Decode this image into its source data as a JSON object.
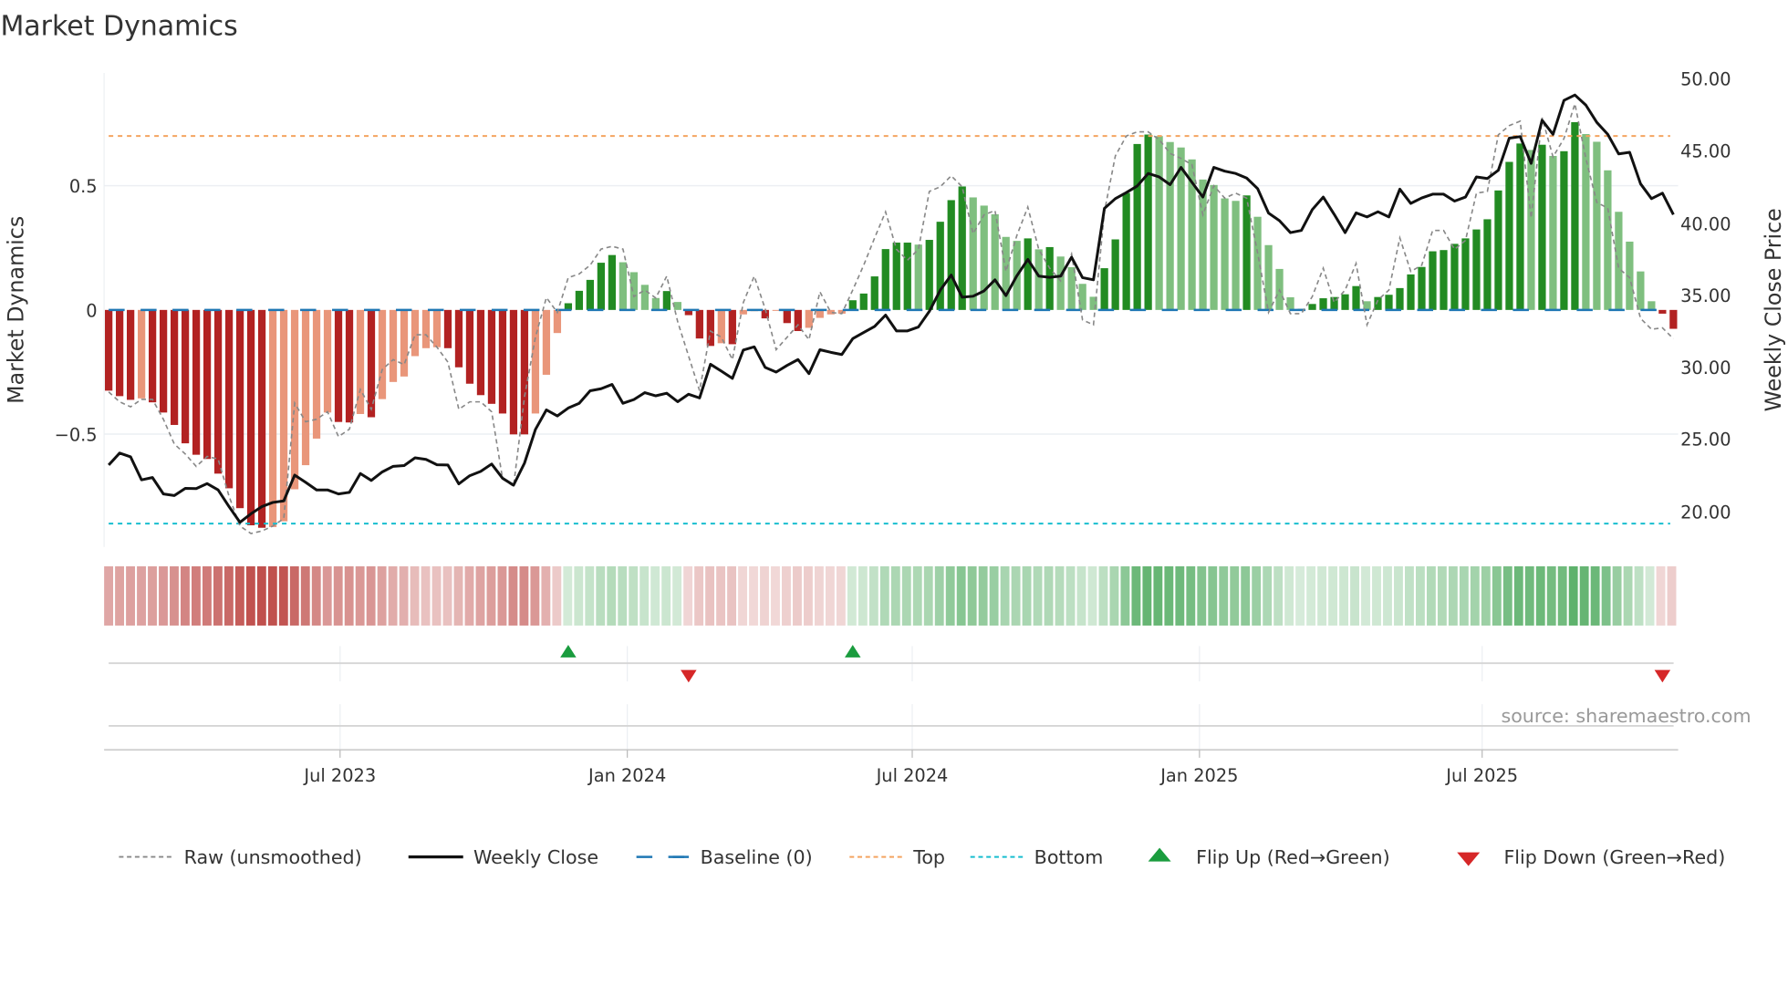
{
  "title": "Market Dynamics",
  "source": "source: sharemaestro.com",
  "colors": {
    "neg_strong": "#b22222",
    "neg_weak": "#e9967a",
    "pos_strong": "#228b22",
    "pos_weak": "#7fbf7f",
    "close": "#111111",
    "raw": "#888888",
    "baseline": "#1f77b4",
    "top": "#f4a460",
    "bottom": "#17becf",
    "flip_up": "#1a9c3e",
    "flip_down": "#d62728",
    "heat_neg": "#c0504d",
    "heat_pos": "#4aa85a"
  },
  "legend": {
    "raw": "Raw (unsmoothed)",
    "close": "Weekly Close",
    "baseline": "Baseline (0)",
    "top": "Top",
    "bottom": "Bottom",
    "flip_up": "Flip Up (Red→Green)",
    "flip_down": "Flip Down (Green→Red)"
  },
  "chart_data": {
    "type": "bar",
    "title": "Market Dynamics",
    "ylabel": "Market Dynamics",
    "y2label": "Weekly Close Price",
    "ylim": [
      -0.95,
      0.95
    ],
    "y2lim": [
      17.5,
      51
    ],
    "yticks": [
      "0.5",
      "0",
      "−0.5"
    ],
    "y2ticks": [
      "50.00",
      "45.00",
      "40.00",
      "35.00",
      "30.00",
      "25.00",
      "20.00"
    ],
    "xticks": [
      "Jul 2023",
      "Jan 2024",
      "Jul 2024",
      "Jan 2025",
      "Jul 2025"
    ],
    "levels": {
      "top": 0.7,
      "baseline": 0,
      "bottom": -0.86
    },
    "flips": {
      "up": [
        42,
        68
      ],
      "down": [
        53,
        142
      ]
    },
    "series": [
      {
        "name": "Market Dynamics (smoothed)",
        "type": "bar",
        "values": [
          -0.325,
          -0.347,
          -0.362,
          -0.356,
          -0.372,
          -0.413,
          -0.463,
          -0.537,
          -0.583,
          -0.6,
          -0.659,
          -0.718,
          -0.798,
          -0.867,
          -0.877,
          -0.874,
          -0.851,
          -0.722,
          -0.625,
          -0.518,
          -0.413,
          -0.451,
          -0.453,
          -0.419,
          -0.432,
          -0.359,
          -0.29,
          -0.268,
          -0.186,
          -0.154,
          -0.15,
          -0.154,
          -0.231,
          -0.297,
          -0.343,
          -0.378,
          -0.417,
          -0.501,
          -0.501,
          -0.417,
          -0.261,
          -0.093,
          0.027,
          0.077,
          0.121,
          0.19,
          0.221,
          0.192,
          0.152,
          0.101,
          0.048,
          0.076,
          0.032,
          -0.021,
          -0.115,
          -0.145,
          -0.134,
          -0.138,
          -0.018,
          -0.005,
          -0.034,
          -0.003,
          -0.053,
          -0.085,
          -0.072,
          -0.032,
          -0.018,
          -0.015,
          0.039,
          0.066,
          0.135,
          0.245,
          0.271,
          0.271,
          0.263,
          0.282,
          0.355,
          0.442,
          0.497,
          0.453,
          0.42,
          0.385,
          0.294,
          0.278,
          0.288,
          0.244,
          0.253,
          0.215,
          0.172,
          0.105,
          0.053,
          0.168,
          0.284,
          0.471,
          0.668,
          0.706,
          0.7,
          0.676,
          0.654,
          0.606,
          0.525,
          0.503,
          0.449,
          0.439,
          0.461,
          0.375,
          0.261,
          0.165,
          0.051,
          0.005,
          0.024,
          0.047,
          0.052,
          0.063,
          0.096,
          0.035,
          0.052,
          0.061,
          0.088,
          0.143,
          0.173,
          0.236,
          0.241,
          0.266,
          0.288,
          0.324,
          0.365,
          0.481,
          0.596,
          0.67,
          0.644,
          0.665,
          0.62,
          0.639,
          0.756,
          0.708,
          0.677,
          0.562,
          0.395,
          0.275,
          0.155,
          0.035,
          -0.015,
          -0.076
        ]
      },
      {
        "name": "Raw (unsmoothed)",
        "type": "line",
        "values": [
          -0.33,
          -0.37,
          -0.39,
          -0.36,
          -0.36,
          -0.44,
          -0.54,
          -0.58,
          -0.63,
          -0.59,
          -0.6,
          -0.75,
          -0.87,
          -0.9,
          -0.89,
          -0.87,
          -0.84,
          -0.375,
          -0.45,
          -0.44,
          -0.41,
          -0.51,
          -0.48,
          -0.32,
          -0.4,
          -0.24,
          -0.2,
          -0.22,
          -0.1,
          -0.1,
          -0.15,
          -0.21,
          -0.4,
          -0.37,
          -0.37,
          -0.41,
          -0.68,
          -0.71,
          -0.35,
          -0.11,
          0.05,
          -0.01,
          0.13,
          0.145,
          0.18,
          0.245,
          0.256,
          0.245,
          0.054,
          0.08,
          0.048,
          0.136,
          -0.047,
          -0.186,
          -0.325,
          -0.085,
          -0.11,
          -0.2,
          0.03,
          0.136,
          0.004,
          -0.16,
          -0.11,
          -0.06,
          -0.12,
          0.073,
          -0.01,
          -0.015,
          0.08,
          0.18,
          0.29,
          0.395,
          0.244,
          0.2,
          0.244,
          0.477,
          0.496,
          0.54,
          0.496,
          0.307,
          0.383,
          0.4,
          0.155,
          0.3,
          0.414,
          0.244,
          0.168,
          0.117,
          0.225,
          -0.04,
          -0.06,
          0.395,
          0.62,
          0.7,
          0.717,
          0.717,
          0.686,
          0.63,
          0.61,
          0.585,
          0.383,
          0.5,
          0.45,
          0.47,
          0.45,
          0.23,
          -0.01,
          0.08,
          -0.015,
          -0.015,
          0.054,
          0.168,
          0.03,
          0.08,
          0.187,
          -0.06,
          0.04,
          0.08,
          0.29,
          0.155,
          0.18,
          0.32,
          0.32,
          0.244,
          0.28,
          0.47,
          0.477,
          0.705,
          0.742,
          0.76,
          0.37,
          0.774,
          0.616,
          0.69,
          0.83,
          0.61,
          0.433,
          0.41,
          0.168,
          0.13,
          -0.034,
          -0.078,
          -0.072,
          -0.116
        ]
      },
      {
        "name": "Weekly Close",
        "type": "line",
        "axis": "right",
        "values": [
          23.15,
          23.98,
          23.72,
          22.12,
          22.28,
          21.14,
          21.03,
          21.53,
          21.51,
          21.86,
          21.42,
          20.26,
          19.17,
          19.76,
          20.26,
          20.55,
          20.66,
          22.45,
          21.95,
          21.42,
          21.42,
          21.14,
          21.25,
          22.56,
          22.08,
          22.67,
          23.06,
          23.11,
          23.65,
          23.54,
          23.17,
          23.15,
          21.84,
          22.41,
          22.71,
          23.22,
          22.23,
          21.75,
          23.28,
          25.62,
          26.98,
          26.56,
          27.11,
          27.44,
          28.31,
          28.45,
          28.75,
          27.44,
          27.7,
          28.18,
          27.96,
          28.14,
          27.55,
          28.07,
          27.81,
          30.15,
          29.67,
          29.17,
          31.14,
          31.36,
          29.93,
          29.61,
          30.07,
          30.48,
          29.5,
          31.16,
          30.98,
          30.83,
          31.93,
          32.36,
          32.78,
          33.57,
          32.47,
          32.47,
          32.74,
          33.83,
          35.3,
          36.35,
          34.81,
          34.88,
          35.25,
          36.02,
          34.92,
          36.3,
          37.44,
          36.28,
          36.19,
          36.28,
          37.59,
          36.17,
          36.02,
          40.98,
          41.66,
          42.08,
          42.54,
          43.41,
          43.17,
          42.63,
          43.83,
          42.8,
          41.77,
          43.83,
          43.57,
          43.41,
          43.09,
          42.36,
          40.66,
          40.13,
          39.3,
          39.45,
          40.9,
          41.77,
          40.57,
          39.3,
          40.67,
          40.39,
          40.75,
          40.39,
          42.32,
          41.33,
          41.71,
          41.97,
          41.97,
          41.49,
          41.77,
          43.17,
          43.06,
          43.63,
          45.86,
          45.97,
          44.11,
          47.11,
          46.13,
          48.49,
          48.86,
          48.16,
          46.96,
          46.13,
          44.77,
          44.88,
          42.69,
          41.66,
          42.04,
          40.55
        ]
      }
    ]
  }
}
